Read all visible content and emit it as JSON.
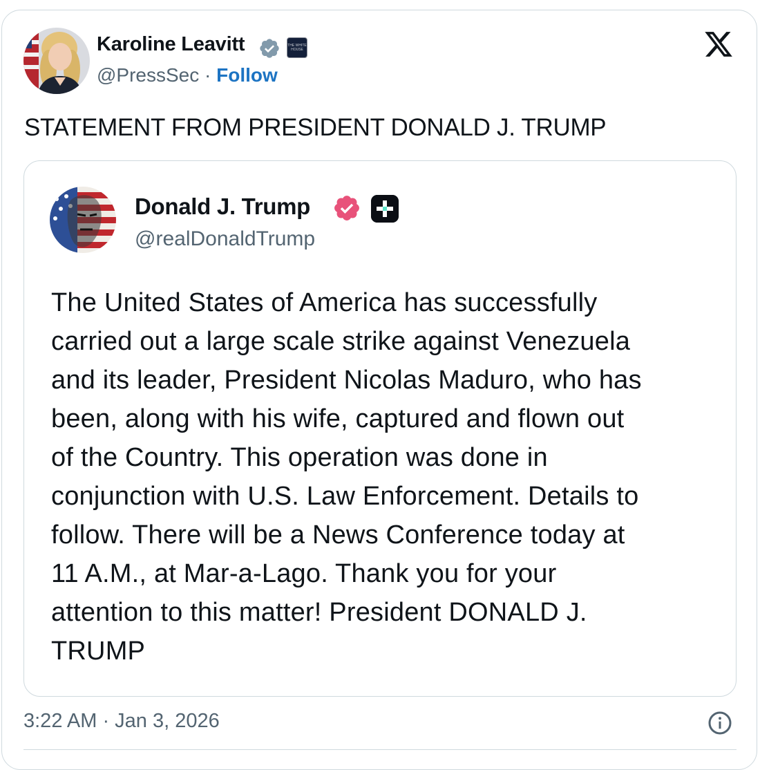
{
  "author": {
    "name": "Karoline Leavitt",
    "handle": "@PressSec",
    "separator": "·",
    "follow_label": "Follow",
    "verified_badge_color": "#829aab",
    "affiliation_badge_text": "THE WHITE HOUSE"
  },
  "post": {
    "text": "STATEMENT FROM PRESIDENT DONALD J. TRUMP",
    "timestamp": "3:22 AM · Jan 3, 2026"
  },
  "quoted_post": {
    "name": "Donald J. Trump",
    "handle": "@realDonaldTrump",
    "verified_badge_color": "#e8527a",
    "body_lines": [
      "The United States of America has successfully",
      "carried out a large scale strike against Venezuela",
      "and its leader, President Nicolas Maduro, who has",
      "been, along with his wife, captured and flown out",
      "of the Country. This operation was done in",
      "conjunction with U.S. Law Enforcement. Details to",
      "follow. There will be a News Conference today at",
      "11 A.M., at Mar-a-Lago. Thank you for your",
      "attention to this matter! President DONALD J.",
      "TRUMP"
    ]
  },
  "icons": {
    "brand": "x-logo-icon",
    "info": "info-icon",
    "verified": "verified-check-icon",
    "platform": "truth-social-plus-icon"
  }
}
